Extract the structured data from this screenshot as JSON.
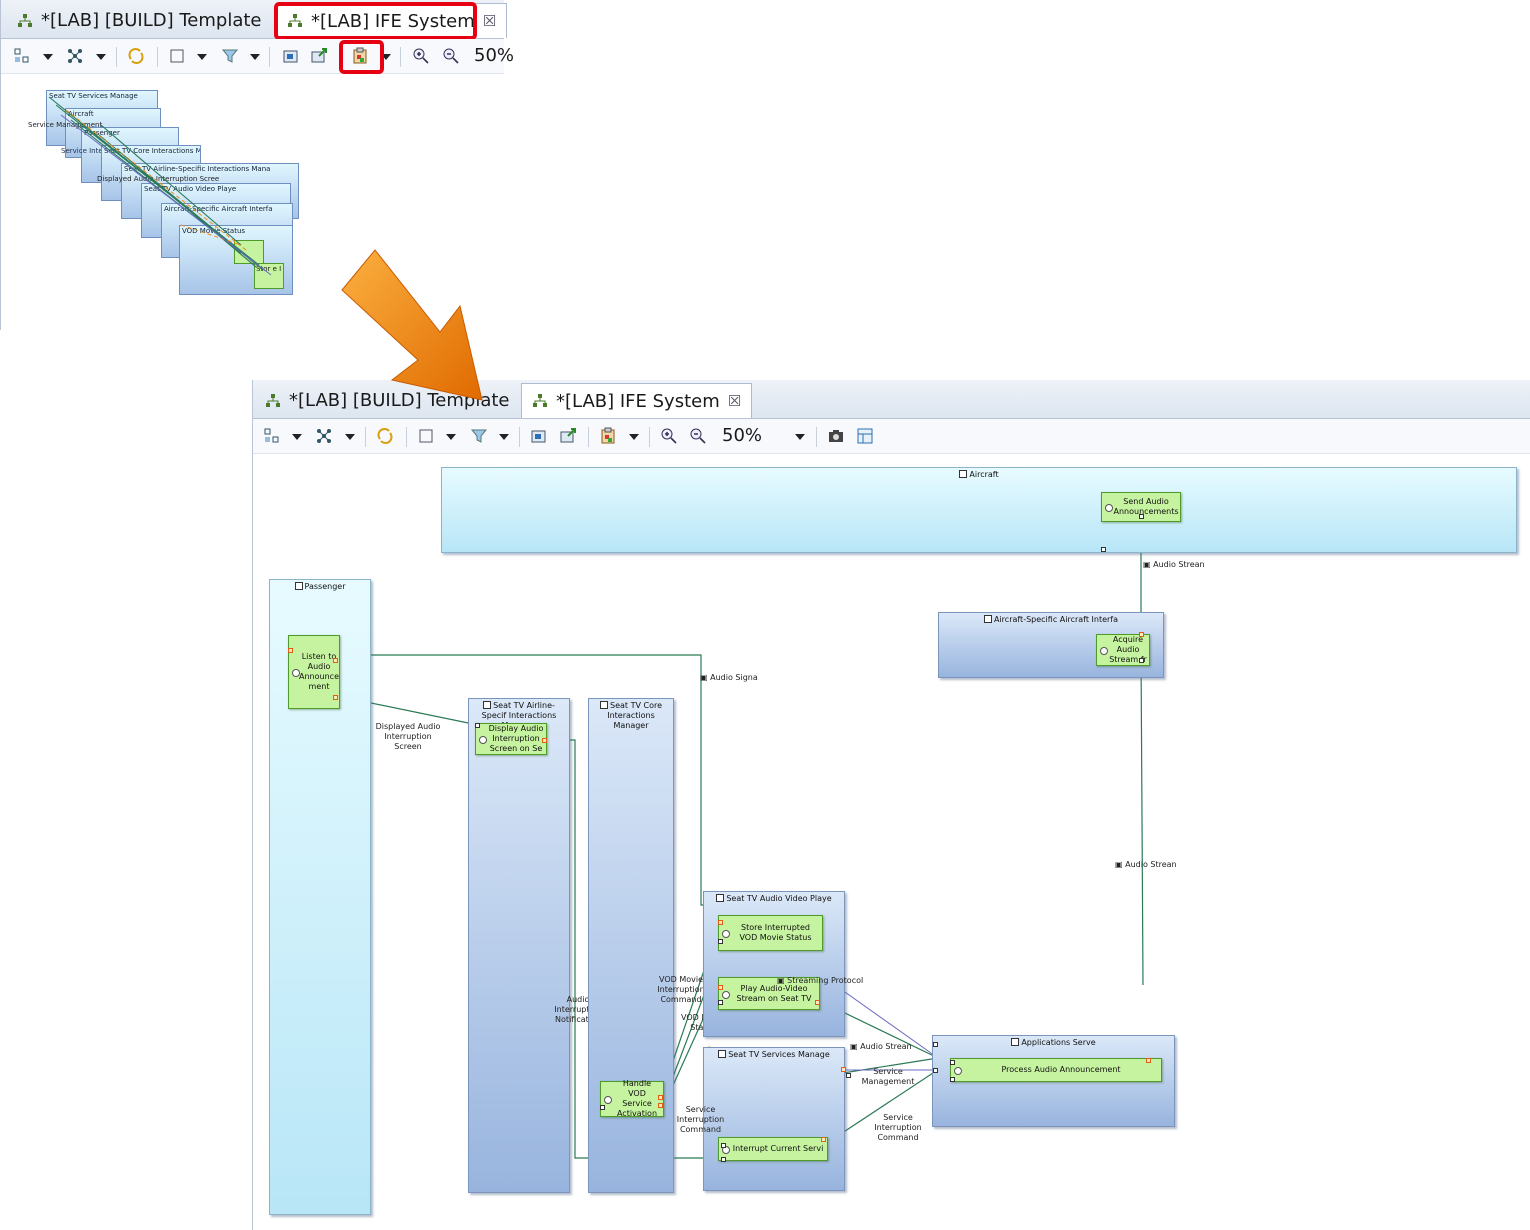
{
  "tabs": [
    {
      "label": "*[LAB] [BUILD] Template"
    },
    {
      "label": "*[LAB] IFE System"
    }
  ],
  "toolbar": {
    "zoom_label": "50%"
  },
  "icons": {
    "tab_icon": "diagram-icon",
    "close": "close-icon",
    "arrange": "arrange-icon",
    "layout": "layout-icon",
    "refresh": "refresh-icon",
    "select": "select-icon",
    "filter": "filter-icon",
    "export": "export-icon",
    "paste": "paste-layout-icon",
    "zoom_in": "zoom-in-icon",
    "zoom_out": "zoom-out-icon",
    "camera": "camera-icon"
  },
  "colors": {
    "highlight": "#e60012",
    "arrow": "#f08a10",
    "function_fill": "#c6f3a0"
  },
  "overview": {
    "labels": [
      "Seat TV Services Manage",
      "Aircraft",
      "Service Management",
      "Passenger",
      "Service Interruption Comman",
      "Seat TV Airline-Specific Interactions Mana",
      "Displayed Audio Interruption Scree",
      "Seat TV Core Interactions Manag",
      "Seat TV Audio Video Playe",
      "Aircraft-Specific Aircraft Interfa",
      "VOD Movie Status",
      "Stor e I"
    ]
  },
  "diagram": {
    "components": {
      "aircraft": "Aircraft",
      "passenger": "Passenger",
      "aircraft_interface": "Aircraft-Specific Aircraft Interfa",
      "airline_interactions": "Seat TV Airline-Specif Interactions Manager",
      "core_interactions": "Seat TV Core Interactions Manager",
      "audio_video_player": "Seat TV Audio Video Playe",
      "services_manager": "Seat TV Services Manage",
      "applications_server": "Applications Serve"
    },
    "functions": {
      "send_audio": "Send Audio Announcements",
      "listen_audio": "Listen to Audio Announce ment",
      "acquire_audio": "Acquire Audio Stream fr",
      "display_audio": "Display Audio Interruption Screen on Se",
      "store_interrupted": "Store Interrupted VOD Movie Status",
      "play_av": "Play Audio-Video Stream on Seat TV",
      "handle_vod": "Handle VOD Service Activation",
      "interrupt_service": "Interrupt Current Servi",
      "process_audio": "Process Audio Announcement"
    },
    "exchanges": {
      "audio_stream_1": "Audio Strean",
      "audio_stream_2": "Audio Strean",
      "audio_signal": "Audio Signa",
      "displayed_audio": "Displayed Audio Interruption Screen",
      "audio_notification": "Audio Interruption Notification",
      "vod_interruption": "VOD Movie Interruption Command",
      "vod_status": "VOD Movie Status",
      "streaming_protocol": "Streaming Protocol",
      "audio_stream_3": "Audio Strean",
      "service_management": "Service Management",
      "service_interruption_1": "Service Interruption Command",
      "service_interruption_2": "Service Interruption Command"
    }
  }
}
